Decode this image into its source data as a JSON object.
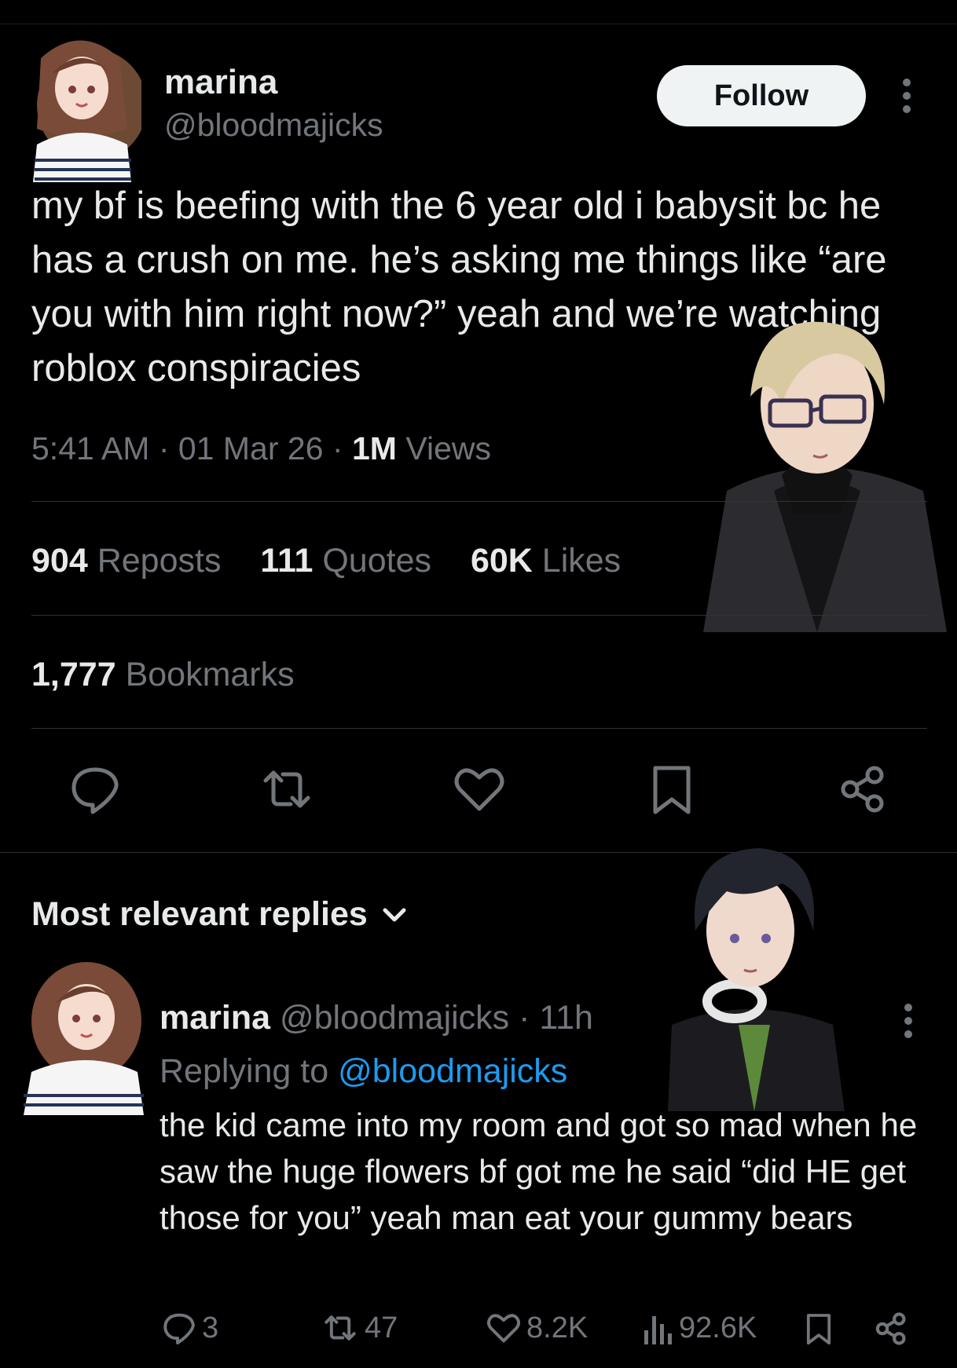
{
  "colors": {
    "background": "#000000",
    "text": "#e7e9ea",
    "muted": "#71767b",
    "link": "#1d9bf0",
    "follow_bg": "#eff3f4"
  },
  "tweet": {
    "author_name": "marina",
    "author_handle": "@bloodmajicks",
    "follow_label": "Follow",
    "text": "my bf is beefing with the 6 year old i babysit bc he has a crush on me. he’s asking me things like “are you with him right now?” yeah and we’re watching roblox conspiracies",
    "time": "5:41 AM",
    "date": "01 Mar 26",
    "views_count": "1M",
    "views_label": "Views",
    "reposts_count": "904",
    "reposts_label": "Reposts",
    "quotes_count": "111",
    "quotes_label": "Quotes",
    "likes_count": "60K",
    "likes_label": "Likes",
    "bookmarks_count": "1,777",
    "bookmarks_label": "Bookmarks",
    "actions": [
      "reply-icon",
      "repost-icon",
      "like-icon",
      "bookmark-icon",
      "share-icon"
    ]
  },
  "replies_header": "Most relevant replies",
  "reply": {
    "author_name": "marina",
    "author_handle": "@bloodmajicks",
    "time": "11h",
    "replying_prefix": "Replying to",
    "replying_handle": "@bloodmajicks",
    "text": "the kid came into my room and got so mad when he saw the huge flowers bf got me he said  “did HE get those for you” yeah man eat your gummy bears",
    "reply_count": "3",
    "repost_count": "47",
    "like_count": "8.2K",
    "view_count": "92.6K"
  }
}
